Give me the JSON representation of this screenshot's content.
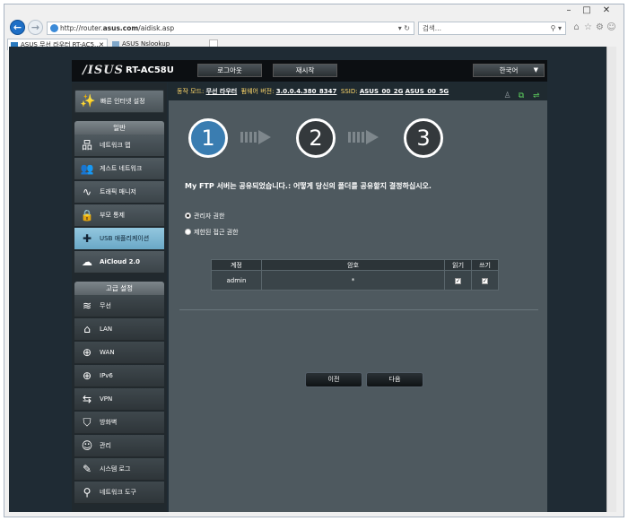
{
  "browser": {
    "url_prefix": "http://router.",
    "url_host": "asus.com",
    "url_path": "/aidisk.asp",
    "search_placeholder": "검색...",
    "tabs": [
      {
        "label": "ASUS 무선 라우터 RT-AC5...",
        "active": true
      },
      {
        "label": "ASUS Nslookup",
        "active": false
      }
    ]
  },
  "router": {
    "brand": "/ISUS",
    "model": "RT-AC58U",
    "logout_label": "로그아웃",
    "reboot_label": "재시작",
    "language": "한국어"
  },
  "status": {
    "mode_label": "동작 모드:",
    "mode_value": "무선 라우터",
    "firmware_label": "펌웨어 버전:",
    "firmware_value": "3.0.0.4.380_8347",
    "ssid_label": "SSID:",
    "ssid_1": "ASUS_00_2G",
    "ssid_2": "ASUS_00_5G"
  },
  "sidebar": {
    "quick_setup": "빠른 인터넷 설정",
    "general_header": "일반",
    "general_items": [
      {
        "label": "네트워크 맵",
        "icon": "network-map-icon"
      },
      {
        "label": "게스트 네트워크",
        "icon": "guest-network-icon"
      },
      {
        "label": "트래픽 매니저",
        "icon": "traffic-manager-icon"
      },
      {
        "label": "부모 통제",
        "icon": "lock-icon"
      },
      {
        "label": "USB 애플리케이션",
        "icon": "puzzle-icon"
      },
      {
        "label": "AiCloud 2.0",
        "icon": "cloud-icon"
      }
    ],
    "advanced_header": "고급 설정",
    "advanced_items": [
      {
        "label": "무선",
        "icon": "wifi-icon"
      },
      {
        "label": "LAN",
        "icon": "home-icon"
      },
      {
        "label": "WAN",
        "icon": "globe-icon"
      },
      {
        "label": "IPv6",
        "icon": "ipv6-globe-icon"
      },
      {
        "label": "VPN",
        "icon": "vpn-icon"
      },
      {
        "label": "방화벽",
        "icon": "shield-icon"
      },
      {
        "label": "관리",
        "icon": "admin-user-icon"
      },
      {
        "label": "시스템 로그",
        "icon": "system-log-icon"
      },
      {
        "label": "네트워크 도구",
        "icon": "network-tools-icon"
      }
    ],
    "selected": "USB 애플리케이션"
  },
  "wizard": {
    "steps": [
      "1",
      "2",
      "3"
    ],
    "current_step": 1,
    "message": "My FTP 서버는 공유되었습니다.: 어떻게 당신의 폴더를 공유할지 결정하십시오.",
    "options": [
      {
        "label": "관리자 권한",
        "checked": true
      },
      {
        "label": "제한된 접근 권한",
        "checked": false
      }
    ],
    "table": {
      "headers": [
        "계정",
        "암호",
        "읽기",
        "쓰기"
      ],
      "rows": [
        {
          "account": "admin",
          "password": "*",
          "read": true,
          "write": true
        }
      ]
    },
    "prev_label": "이전",
    "next_label": "다음"
  }
}
